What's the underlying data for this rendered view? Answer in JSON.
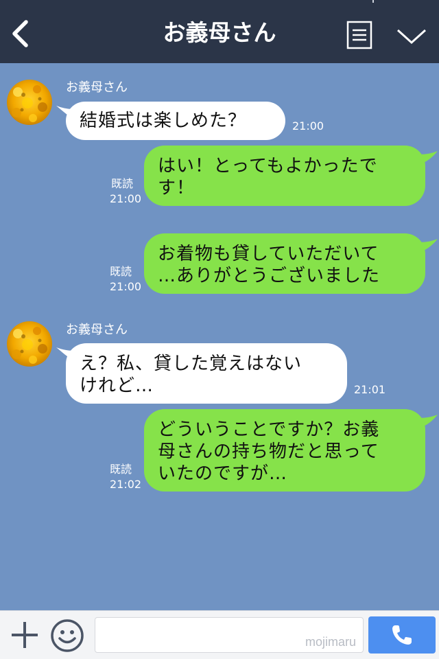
{
  "header": {
    "title": "お義母さん"
  },
  "messages": [
    {
      "sender": "お義母さん",
      "text": "結婚式は楽しめた？",
      "time": "21:00"
    },
    {
      "text_lines": [
        "はい！とってもよかったで",
        "す！"
      ],
      "read": "既読",
      "time": "21:00"
    },
    {
      "text_lines": [
        "お着物も貸していただいて",
        "…ありがとうございました"
      ],
      "read": "既読",
      "time": "21:00"
    },
    {
      "sender": "お義母さん",
      "text_lines": [
        "え？私、貸した覚えはない",
        "けれど…"
      ],
      "time": "21:01"
    },
    {
      "text_lines": [
        "どういうことですか？お義",
        "母さんの持ち物だと思って",
        "いたのですが…"
      ],
      "read": "既読",
      "time": "21:02"
    }
  ],
  "input": {
    "placeholder": "",
    "watermark": "mojimaru"
  },
  "colors": {
    "header_bg": "#2b3548",
    "chat_bg": "#7093c3",
    "incoming_bubble": "#ffffff",
    "outgoing_bubble": "#86e24a",
    "call_button": "#4d8ff0"
  },
  "icons": {
    "back": "chevron-left-icon",
    "menu": "menu-list-icon",
    "collapse": "chevron-down-icon",
    "add": "plus-icon",
    "emoji": "smiley-icon",
    "call": "phone-icon"
  }
}
